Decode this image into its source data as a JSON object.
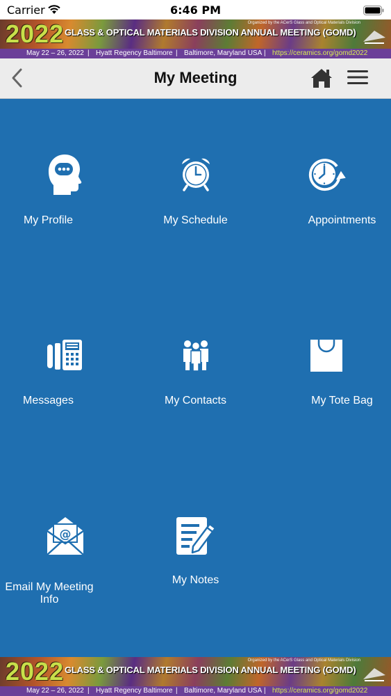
{
  "status_bar": {
    "carrier": "Carrier",
    "time": "6:46 PM"
  },
  "banner": {
    "year": "2022",
    "title": "GLASS & OPTICAL MATERIALS DIVISION ANNUAL MEETING (GOMD)",
    "organizer": "Organized by the ACerS Glass and Optical Materials Division",
    "dates": "May 22 – 26, 2022",
    "venue": "Hyatt Regency Baltimore",
    "location": "Baltimore, Maryland USA",
    "url": "https://ceramics.org/gomd2022",
    "separator": "|"
  },
  "navbar": {
    "title": "My Meeting"
  },
  "tiles": [
    {
      "label": "My Profile",
      "icon": "profile-head-icon"
    },
    {
      "label": "My Schedule",
      "icon": "alarm-clock-icon"
    },
    {
      "label": "Appointments",
      "icon": "clock-arrow-icon"
    },
    {
      "label": "Messages",
      "icon": "fax-phone-icon"
    },
    {
      "label": "My Contacts",
      "icon": "people-group-icon"
    },
    {
      "label": "My Tote Bag",
      "icon": "shopping-bag-icon"
    },
    {
      "label": "Email My Meeting Info",
      "icon": "email-envelope-icon"
    },
    {
      "label": "My Notes",
      "icon": "notes-pencil-icon"
    }
  ],
  "colors": {
    "background": "#1f6fb0",
    "navbar": "#ececec",
    "banner_info_bar": "#6b3f98",
    "banner_year": "#c8e04a",
    "banner_url": "#d9ec53"
  }
}
